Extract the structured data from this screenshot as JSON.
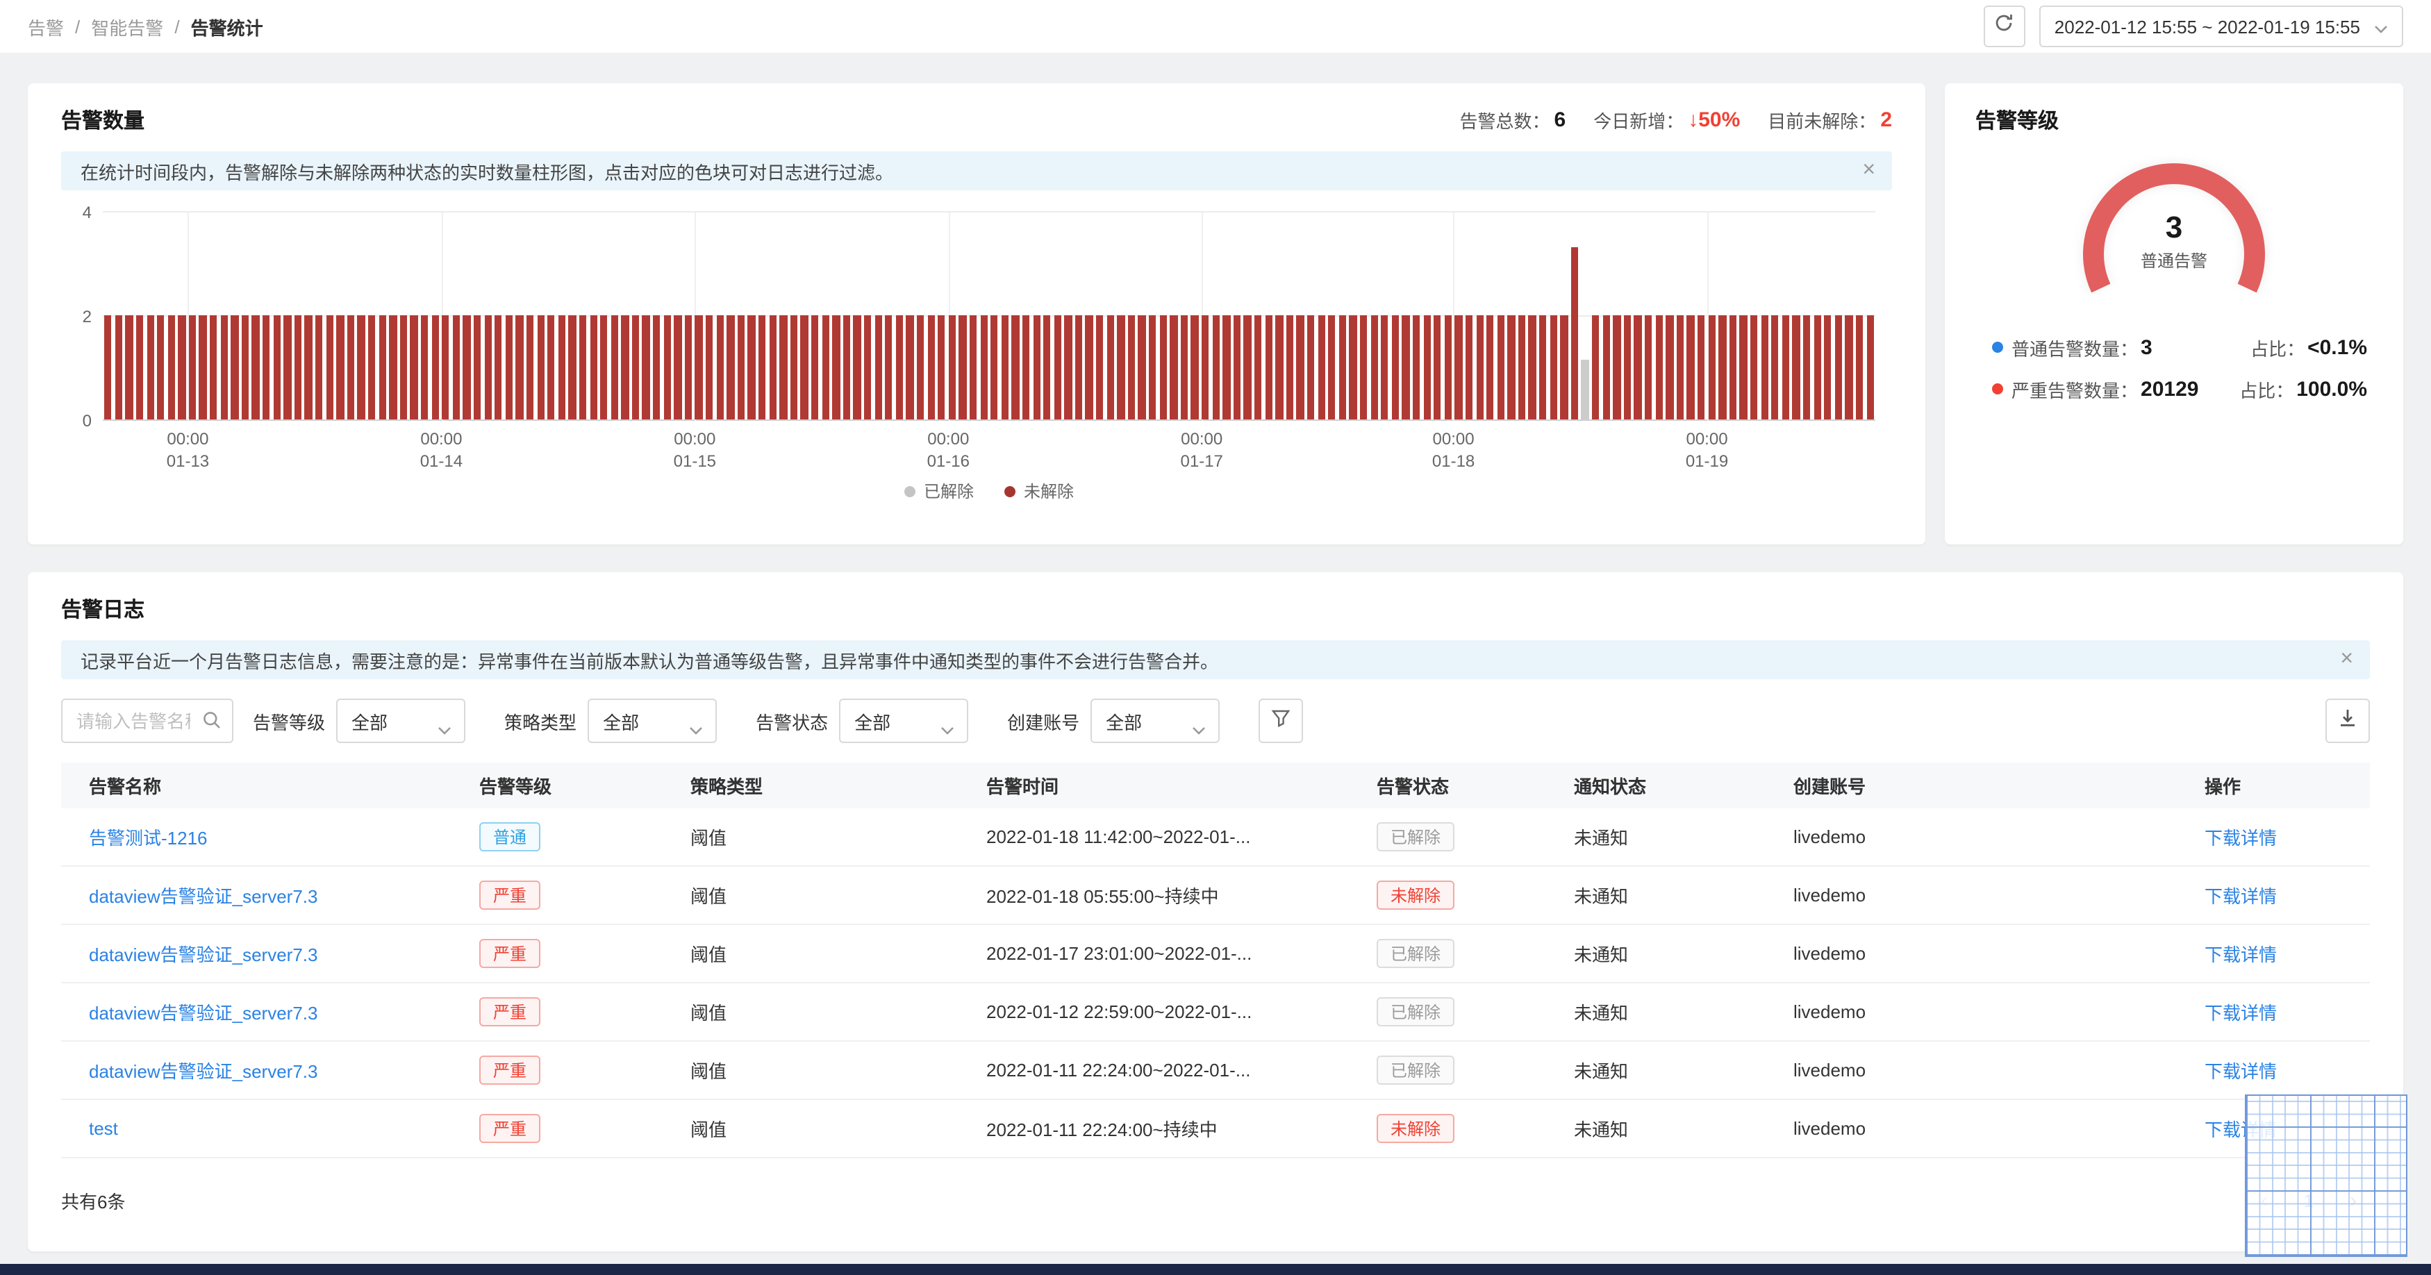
{
  "breadcrumb": {
    "items": [
      "告警",
      "智能告警",
      "告警统计"
    ],
    "separator": "/"
  },
  "toolbar": {
    "date_range": "2022-01-12 15:55 ~ 2022-01-19 15:55"
  },
  "glyphs": {
    "close": "×",
    "arrow_down": "↓",
    "prev": "‹",
    "next": "›"
  },
  "alert_count_card": {
    "title": "告警数量",
    "stats": {
      "total_label": "告警总数：",
      "total_value": "6",
      "new_label": "今日新增：",
      "new_value": "50%",
      "unresolved_label": "目前未解除：",
      "unresolved_value": "2"
    },
    "banner": "在统计时间段内，告警解除与未解除两种状态的实时数量柱形图，点击对应的色块可对日志进行过滤。"
  },
  "chart_data": {
    "type": "bar",
    "time_range": "2022-01-12 15:55 ~ 2022-01-19 15:55",
    "interval": "1h",
    "bar_count": 168,
    "y_max": 4,
    "y_ticks": [
      0,
      2,
      4
    ],
    "x_ticks": [
      {
        "time": "00:00",
        "date": "01-13",
        "frac": 0.048
      },
      {
        "time": "00:00",
        "date": "01-14",
        "frac": 0.191
      },
      {
        "time": "00:00",
        "date": "01-15",
        "frac": 0.334
      },
      {
        "time": "00:00",
        "date": "01-16",
        "frac": 0.477
      },
      {
        "time": "00:00",
        "date": "01-17",
        "frac": 0.62
      },
      {
        "time": "00:00",
        "date": "01-18",
        "frac": 0.762
      },
      {
        "time": "00:00",
        "date": "01-19",
        "frac": 0.905
      }
    ],
    "series": [
      {
        "name": "未解除",
        "color": "#b03a33",
        "default_value": 2,
        "overrides": {
          "139": 3.3,
          "140": 0
        }
      },
      {
        "name": "已解除",
        "color": "#cccccc",
        "default_value": 0,
        "overrides": {
          "140": 1.15
        }
      }
    ],
    "legend": [
      {
        "label": "已解除",
        "color": "#c4c4c4"
      },
      {
        "label": "未解除",
        "color": "#a63530"
      }
    ]
  },
  "alert_level_card": {
    "title": "告警等级",
    "gauge": {
      "value": "3",
      "label": "普通告警",
      "color": "#e25f5f"
    },
    "stats": [
      {
        "label": "普通告警数量：",
        "value": "3",
        "ratio_label": "占比：",
        "ratio": "<0.1%",
        "dot_color": "#2a82e4"
      },
      {
        "label": "严重告警数量：",
        "value": "20129",
        "ratio_label": "占比：",
        "ratio": "100.0%",
        "dot_color": "#f04134"
      }
    ]
  },
  "alert_log_card": {
    "title": "告警日志",
    "banner": "记录平台近一个月告警日志信息，需要注意的是：异常事件在当前版本默认为普通等级告警，且异常事件中通知类型的事件不会进行告警合并。",
    "filters": {
      "search_placeholder": "请输入告警名称",
      "selects": [
        {
          "label": "告警等级",
          "value": "全部"
        },
        {
          "label": "策略类型",
          "value": "全部"
        },
        {
          "label": "告警状态",
          "value": "全部"
        },
        {
          "label": "创建账号",
          "value": "全部"
        }
      ]
    },
    "table": {
      "columns": [
        "告警名称",
        "告警等级",
        "策略类型",
        "告警时间",
        "告警状态",
        "通知状态",
        "创建账号",
        "操作"
      ],
      "rows": [
        {
          "name": "告警测试-1216",
          "level": "普通",
          "level_type": "normal",
          "policy": "阈值",
          "time": "2022-01-18 11:42:00~2022-01-...",
          "status": "已解除",
          "status_type": "resolved",
          "notify": "未通知",
          "account": "livedemo",
          "action": "下载详情"
        },
        {
          "name": "dataview告警验证_server7.3",
          "level": "严重",
          "level_type": "severe",
          "policy": "阈值",
          "time": "2022-01-18 05:55:00~持续中",
          "status": "未解除",
          "status_type": "unresolved",
          "notify": "未通知",
          "account": "livedemo",
          "action": "下载详情"
        },
        {
          "name": "dataview告警验证_server7.3",
          "level": "严重",
          "level_type": "severe",
          "policy": "阈值",
          "time": "2022-01-17 23:01:00~2022-01-...",
          "status": "已解除",
          "status_type": "resolved",
          "notify": "未通知",
          "account": "livedemo",
          "action": "下载详情"
        },
        {
          "name": "dataview告警验证_server7.3",
          "level": "严重",
          "level_type": "severe",
          "policy": "阈值",
          "time": "2022-01-12 22:59:00~2022-01-...",
          "status": "已解除",
          "status_type": "resolved",
          "notify": "未通知",
          "account": "livedemo",
          "action": "下载详情"
        },
        {
          "name": "dataview告警验证_server7.3",
          "level": "严重",
          "level_type": "severe",
          "policy": "阈值",
          "time": "2022-01-11 22:24:00~2022-01-...",
          "status": "已解除",
          "status_type": "resolved",
          "notify": "未通知",
          "account": "livedemo",
          "action": "下载详情"
        },
        {
          "name": "test",
          "level": "严重",
          "level_type": "severe",
          "policy": "阈值",
          "time": "2022-01-11 22:24:00~持续中",
          "status": "未解除",
          "status_type": "unresolved",
          "notify": "未通知",
          "account": "livedemo",
          "action": "下载详情"
        }
      ]
    },
    "footer": {
      "total": "共有6条",
      "page": "1"
    }
  }
}
